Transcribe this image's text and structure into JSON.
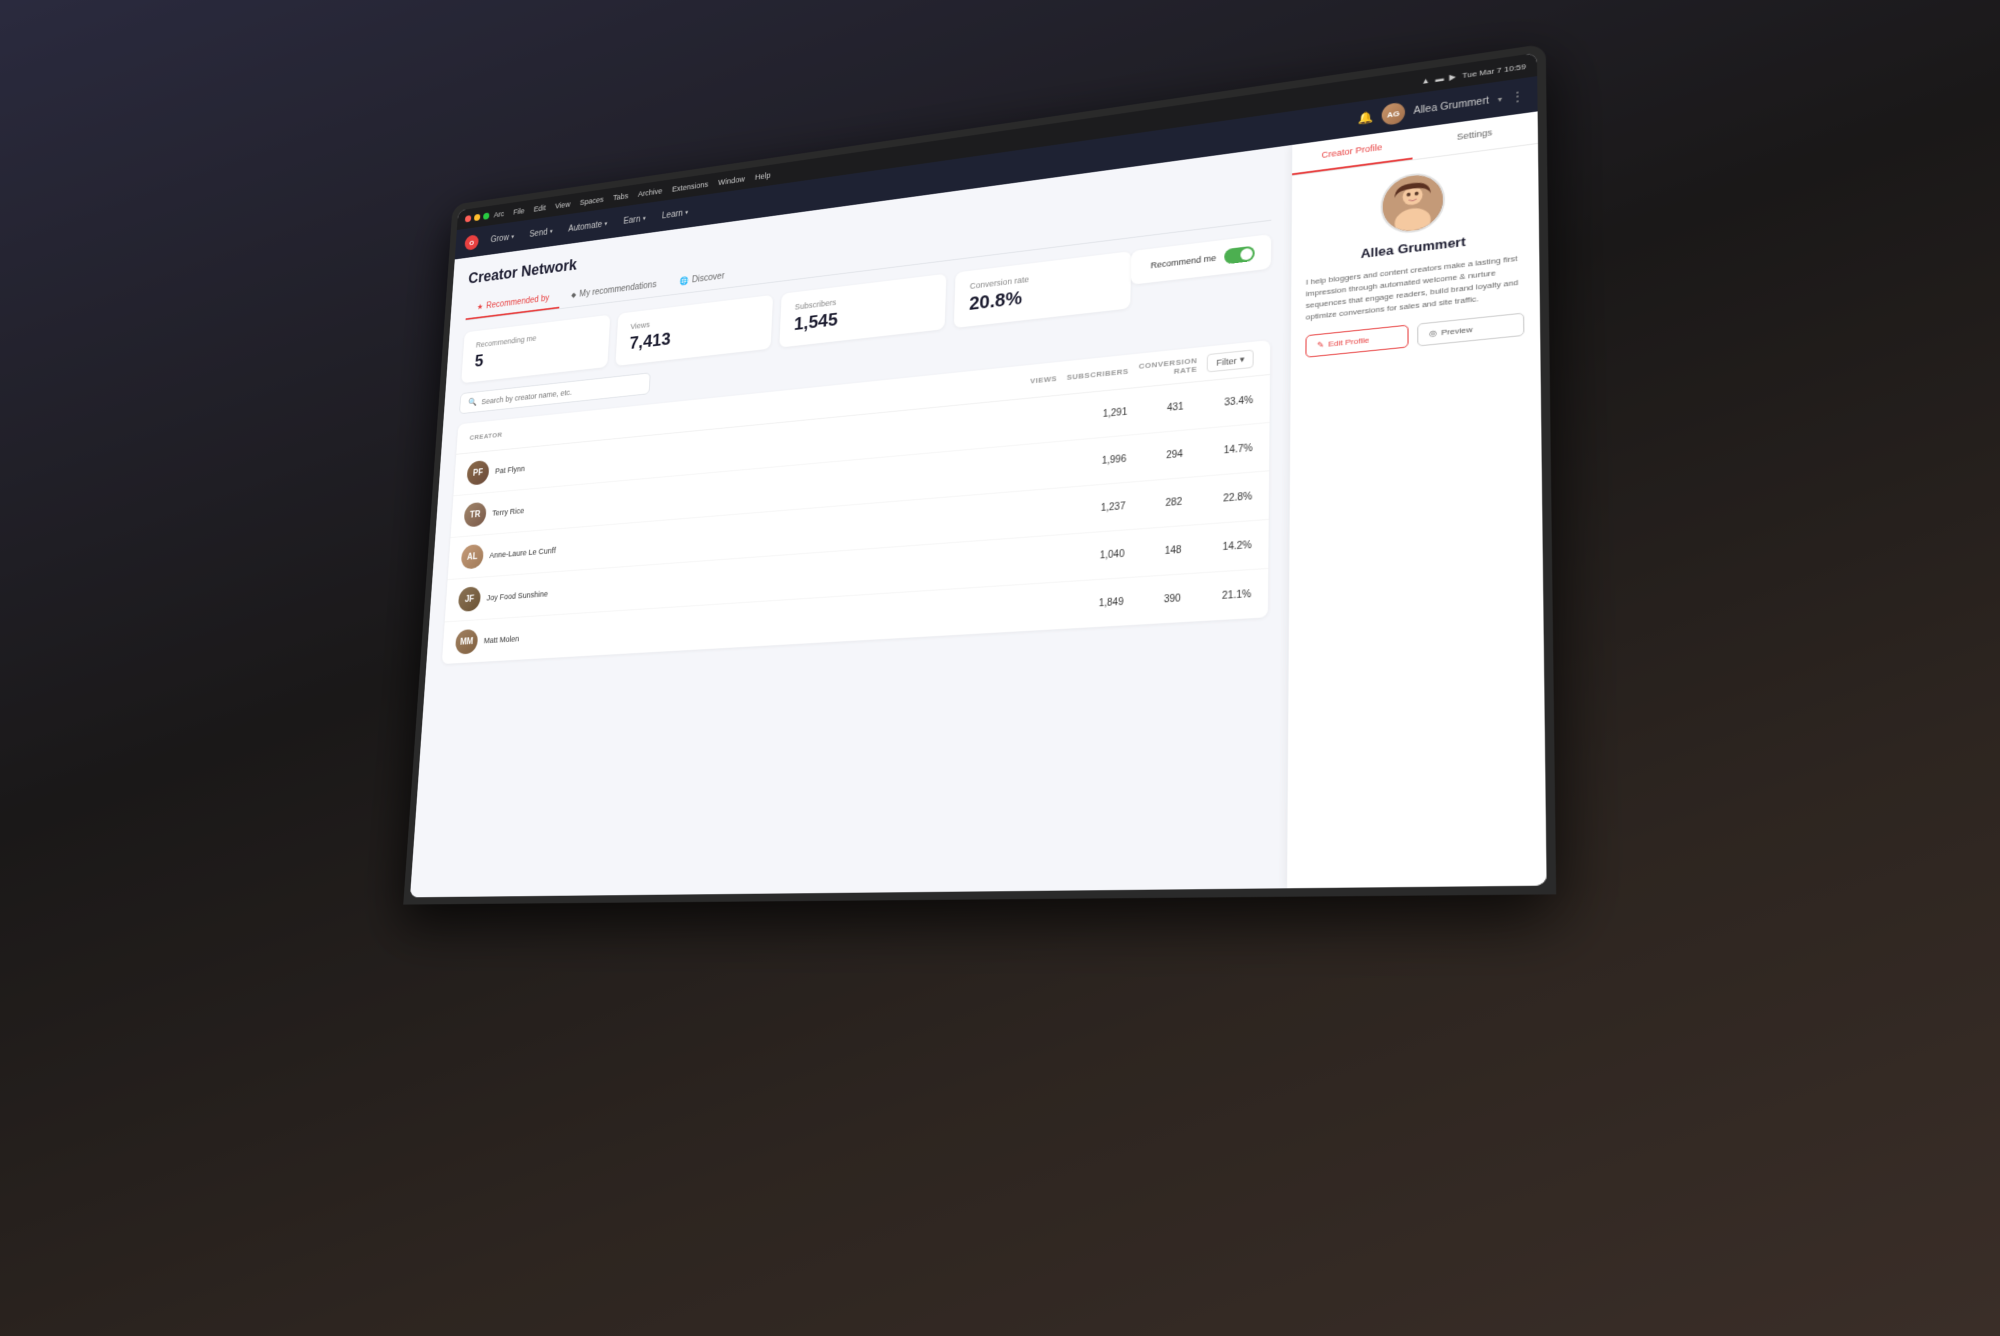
{
  "scene": {
    "bg_color": "#1a1a1e"
  },
  "macos": {
    "time": "Tue Mar 7  10:59",
    "menu_items": [
      "Arc",
      "File",
      "Edit",
      "View",
      "Spaces",
      "Tabs",
      "Archive",
      "Extensions",
      "Window",
      "Help"
    ],
    "dot_colors": [
      "#FF5F57",
      "#FFBD2E",
      "#28CA41"
    ]
  },
  "app": {
    "logo_text": "O",
    "nav_items": [
      {
        "label": "Grow",
        "has_chevron": true
      },
      {
        "label": "Send",
        "has_chevron": true
      },
      {
        "label": "Automate",
        "has_chevron": true
      },
      {
        "label": "Earn",
        "has_chevron": true
      },
      {
        "label": "Learn",
        "has_chevron": true
      }
    ],
    "user_name": "Allea Grummert",
    "user_initials": "AG"
  },
  "page": {
    "title": "Creator Network",
    "tabs": [
      {
        "label": "Recommended by",
        "icon": "★",
        "active": true
      },
      {
        "label": "My recommendations",
        "icon": "♦"
      },
      {
        "label": "Discover",
        "icon": "🌐"
      }
    ]
  },
  "stats": {
    "recommending_me": {
      "label": "Recommending me",
      "value": "5"
    },
    "views": {
      "label": "Views",
      "value": "7,413"
    },
    "subscribers": {
      "label": "Subscribers",
      "value": "1,545"
    },
    "conversion_rate": {
      "label": "Conversion rate",
      "value": "20.8%"
    }
  },
  "recommend_toggle": {
    "label": "Recommend me",
    "enabled": true
  },
  "search": {
    "placeholder": "Search by creator name, etc."
  },
  "table": {
    "columns": {
      "creator": "CREATOR",
      "views": "VIEWS",
      "subscribers": "SUBSCRIBERS",
      "conversion_rate": "CONVERSION RATE"
    },
    "filter_label": "Filter",
    "rows": [
      {
        "name": "Pat Flynn",
        "initials": "PF",
        "views": "1,291",
        "subscribers": "431",
        "conversion_rate": "33.4%"
      },
      {
        "name": "Terry Rice",
        "initials": "TR",
        "views": "1,996",
        "subscribers": "294",
        "conversion_rate": "14.7%"
      },
      {
        "name": "Anne-Laure Le Cunff",
        "initials": "AL",
        "views": "1,237",
        "subscribers": "282",
        "conversion_rate": "22.8%"
      },
      {
        "name": "Joy Food Sunshine",
        "initials": "JF",
        "views": "1,040",
        "subscribers": "148",
        "conversion_rate": "14.2%"
      },
      {
        "name": "Matt Molen",
        "initials": "MM",
        "views": "1,849",
        "subscribers": "390",
        "conversion_rate": "21.1%"
      }
    ]
  },
  "profile": {
    "tabs": [
      {
        "label": "Creator Profile",
        "active": true
      },
      {
        "label": "Settings"
      }
    ],
    "name": "Allea Grummert",
    "bio": "I help bloggers and content creators make a lasting first impression through automated welcome & nurture sequences that engage readers, build brand loyalty and optimize conversions for sales and site traffic.",
    "edit_label": "Edit Profile",
    "preview_label": "Preview"
  }
}
